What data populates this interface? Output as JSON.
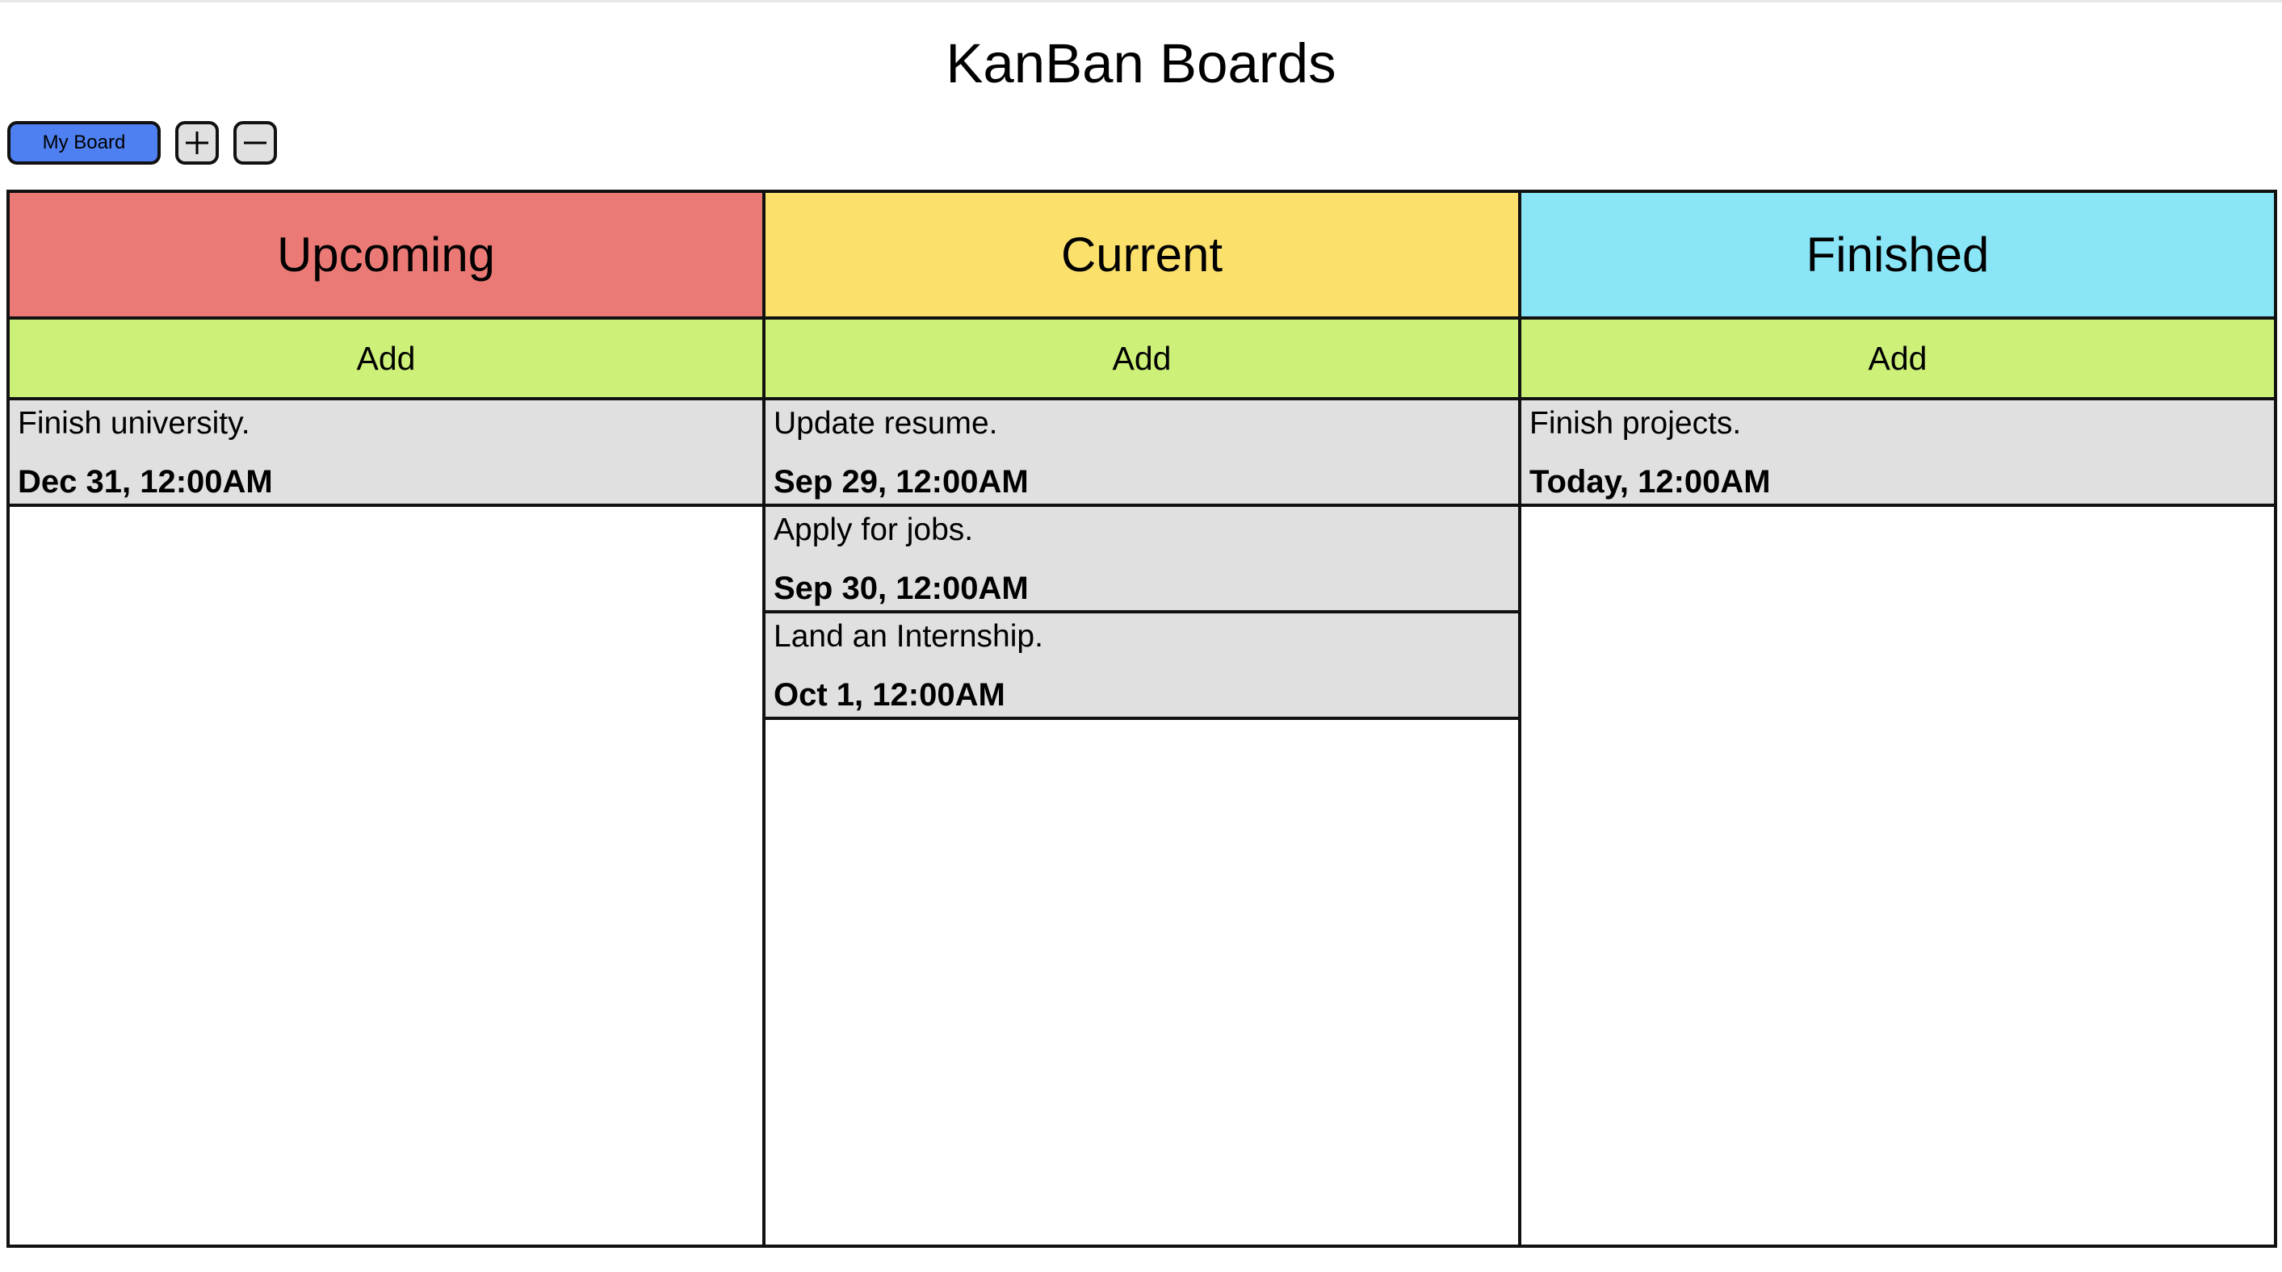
{
  "header": {
    "title": "KanBan Boards"
  },
  "board_bar": {
    "active_board": "My Board",
    "add_icon": "plus-icon",
    "remove_icon": "minus-icon"
  },
  "columns": [
    {
      "title": "Upcoming",
      "color": "#eb7a76",
      "add_label": "Add",
      "cards": [
        {
          "text": "Finish university.",
          "date": "Dec 31, 12:00AM"
        }
      ]
    },
    {
      "title": "Current",
      "color": "#fbe16b",
      "add_label": "Add",
      "cards": [
        {
          "text": "Update resume.",
          "date": "Sep 29, 12:00AM"
        },
        {
          "text": "Apply for jobs.",
          "date": "Sep 30, 12:00AM"
        },
        {
          "text": "Land an Internship.",
          "date": "Oct 1, 12:00AM"
        }
      ]
    },
    {
      "title": "Finished",
      "color": "#8ae6f7",
      "add_label": "Add",
      "cards": [
        {
          "text": "Finish projects.",
          "date": "Today, 12:00AM"
        }
      ]
    }
  ],
  "colors": {
    "add_button": "#ccf078",
    "card_background": "#e0e0e0",
    "board_tab": "#4f80f2"
  }
}
